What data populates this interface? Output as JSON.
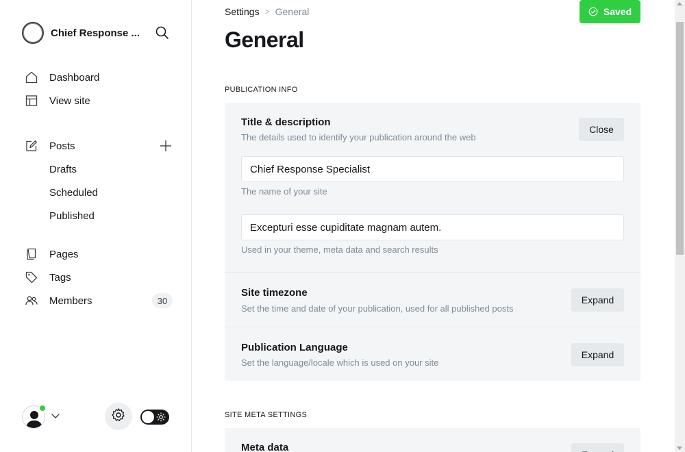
{
  "sidebar": {
    "site_name": "Chief Response ...",
    "nav": {
      "dashboard": "Dashboard",
      "view_site": "View site",
      "posts": "Posts",
      "drafts": "Drafts",
      "scheduled": "Scheduled",
      "published": "Published",
      "pages": "Pages",
      "tags": "Tags",
      "members": "Members",
      "members_count": "30"
    },
    "icons": [
      "search-icon",
      "home-icon",
      "layout-icon",
      "edit-icon",
      "plus-icon",
      "page-icon",
      "tag-icon",
      "members-icon",
      "gear-icon",
      "sun-icon",
      "chevron-down-icon"
    ]
  },
  "header": {
    "breadcrumb_parent": "Settings",
    "breadcrumb_separator": ">",
    "breadcrumb_current": "General",
    "saved_label": "Saved",
    "page_title": "General"
  },
  "publication_info": {
    "section_label": "PUBLICATION INFO",
    "title_description": {
      "title": "Title & description",
      "description": "The details used to identify your publication around the web",
      "button": "Close",
      "site_title_value": "Chief Response Specialist",
      "site_title_hint": "The name of your site",
      "site_description_value": "Excepturi esse cupiditate magnam autem.",
      "site_description_hint": "Used in your theme, meta data and search results"
    },
    "timezone": {
      "title": "Site timezone",
      "description": "Set the time and date of your publication, used for all published posts",
      "button": "Expand"
    },
    "language": {
      "title": "Publication Language",
      "description": "Set the language/locale which is used on your site",
      "button": "Expand"
    }
  },
  "site_meta": {
    "section_label": "SITE META SETTINGS",
    "meta_data": {
      "title": "Meta data",
      "button": "Expand"
    }
  },
  "colors": {
    "accent_green": "#30cf43",
    "text": "#15171a",
    "muted": "#7c8b9a",
    "panel": "#f4f5f6"
  }
}
